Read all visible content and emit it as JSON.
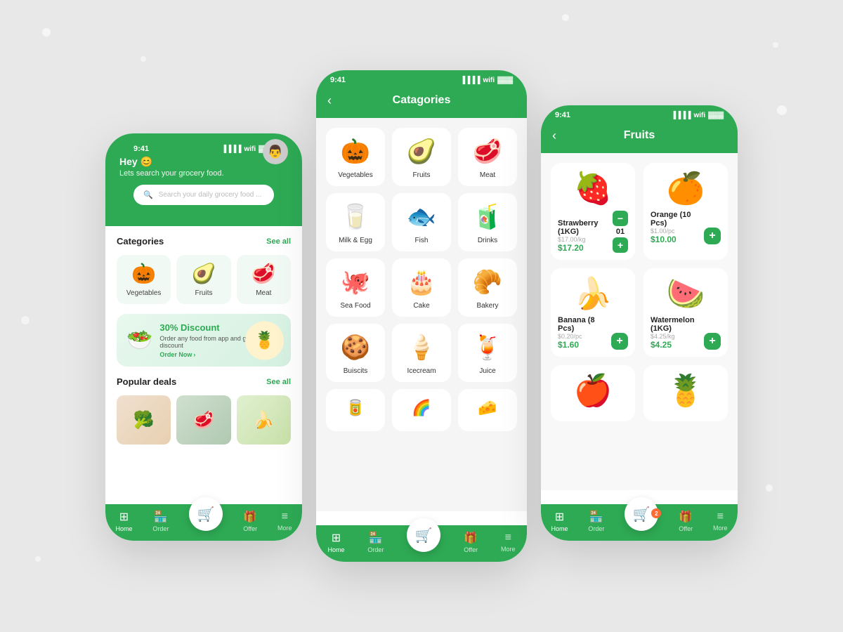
{
  "colors": {
    "green": "#2eaa54",
    "light_green_bg": "#f0f9f3",
    "bg": "#e8e8e8"
  },
  "phone1": {
    "time": "9:41",
    "greeting": "Hey 😊",
    "subtitle": "Lets search your grocery food.",
    "search_placeholder": "Search your daily grocery food ...",
    "categories_title": "Categories",
    "see_all": "See all",
    "categories": [
      {
        "label": "Vegetables",
        "icon": "🎃"
      },
      {
        "label": "Fruits",
        "icon": "🥑"
      },
      {
        "label": "Meat",
        "icon": "🥩"
      }
    ],
    "discount": {
      "percent": "30% Discount",
      "desc": "Order any food from app and get the discount",
      "cta": "Order Now"
    },
    "popular_title": "Popular deals",
    "see_all2": "See all",
    "nav": [
      "Home",
      "Order",
      "Offer",
      "More"
    ]
  },
  "phone2": {
    "time": "9:41",
    "title": "Catagories",
    "categories": [
      {
        "label": "Vegetables",
        "icon": "🎃"
      },
      {
        "label": "Fruits",
        "icon": "🥑"
      },
      {
        "label": "Meat",
        "icon": "🥩"
      },
      {
        "label": "Milk & Egg",
        "icon": "🥛"
      },
      {
        "label": "Fish",
        "icon": "🐟"
      },
      {
        "label": "Drinks",
        "icon": "🧃"
      },
      {
        "label": "Sea Food",
        "icon": "🐙"
      },
      {
        "label": "Cake",
        "icon": "🎂"
      },
      {
        "label": "Bakery",
        "icon": "🥐"
      },
      {
        "label": "Buiscits",
        "icon": "🍪"
      },
      {
        "label": "Icecream",
        "icon": "🍦"
      },
      {
        "label": "Juice",
        "icon": "🧃"
      }
    ],
    "nav": [
      "Home",
      "Order",
      "Offer",
      "More"
    ]
  },
  "phone3": {
    "time": "9:41",
    "title": "Fruits",
    "products": [
      {
        "name": "Strawberry (1KG)",
        "orig_price": "$17.00/kg",
        "price": "$17.20",
        "icon": "🍓",
        "has_qty": true,
        "qty": "01"
      },
      {
        "name": "Orange (10 Pcs)",
        "orig_price": "$1.00/pc",
        "price": "$10.00",
        "icon": "🍊",
        "has_qty": false
      },
      {
        "name": "Banana (8 Pcs)",
        "orig_price": "$0.20/pc",
        "price": "$1.60",
        "icon": "🍌",
        "has_qty": false
      },
      {
        "name": "Watermelon (1KG)",
        "orig_price": "$4.25/kg",
        "price": "$4.25",
        "icon": "🍉",
        "has_qty": false
      }
    ],
    "nav": [
      "Home",
      "Order",
      "Offer",
      "More"
    ],
    "cart_badge": "2"
  }
}
